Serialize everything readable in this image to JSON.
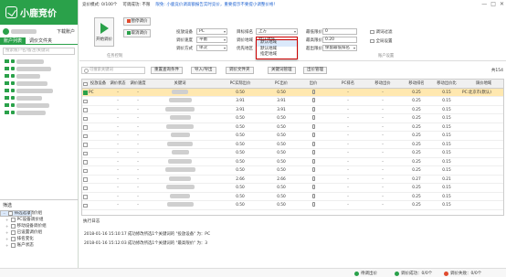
{
  "app": {
    "name": "小鹿竞价"
  },
  "user": {
    "download_label": "下载账户"
  },
  "sidebar": {
    "tabs": [
      "账户列表",
      "调价文件夹"
    ],
    "search_placeholder": "搜索账户名/备注/关键词",
    "accounts": [
      "",
      "",
      "",
      "",
      "",
      "",
      "",
      ""
    ]
  },
  "filter": {
    "title": "筛选",
    "items": [
      {
        "label": "筛选选项",
        "toggle": "−",
        "selected": true
      },
      {
        "label": "未设置调价组",
        "toggle": "",
        "selected": false
      },
      {
        "label": "PC设备调价组",
        "toggle": "+",
        "selected": false
      },
      {
        "label": "移动设备调价组",
        "toggle": "+",
        "selected": false
      },
      {
        "label": "已设置调价组",
        "toggle": "+",
        "selected": false
      },
      {
        "label": "排名变化",
        "toggle": "+",
        "selected": false
      },
      {
        "label": "账户状态",
        "toggle": "+",
        "selected": false
      }
    ]
  },
  "status_bar": {
    "left": "竞价模式: 0/100个",
    "mid": "可调成功: 不限",
    "link": "限免: 小鹿竞价调高额报告实时竞价，重要提示不要提小调整价格！",
    "win": [
      "—",
      "□",
      "✕"
    ]
  },
  "controls": {
    "start": "开始调价",
    "pause": "暂停调价",
    "cancel": "取消调价",
    "group_task": "任务控制",
    "group_settings": "账户设置",
    "group_account": "账户设置",
    "fields": [
      {
        "label": "投放设备",
        "value": "PC"
      },
      {
        "label": "调价速度",
        "value": "平衡"
      },
      {
        "label": "调价方式",
        "value": "单次"
      },
      {
        "label": "目标排名",
        "value": "上方"
      },
      {
        "label": "调价地域",
        "value": "默认地域"
      },
      {
        "label": "优先地区",
        "value": "全部地域"
      },
      {
        "label": "最低限价",
        "value": "0"
      },
      {
        "label": "最高限价",
        "value": "0.20"
      },
      {
        "label": "超出限价",
        "value": "保留最低排名"
      }
    ],
    "region_options": [
      "默认地域",
      "默认地域",
      "指定地域"
    ],
    "checks": [
      "调词过滤",
      "全局设置"
    ]
  },
  "toolbar": {
    "search_placeholder": "可搜索关键词",
    "buttons": [
      "重置查询条件",
      "导入/导出",
      "调价文件夹",
      "关键词管理",
      "出价管理"
    ],
    "count": "共154"
  },
  "table": {
    "headers": [
      "投放设备",
      "调价状态",
      "调价速度",
      "关键词",
      "PC实际出价",
      "PC出价",
      "出价",
      "PC排名",
      "移动出价",
      "移动排名",
      "移动出价比",
      "调价地域"
    ],
    "rows": [
      [
        "PC",
        "",
        "",
        "",
        "0.50",
        "0.50",
        "",
        "",
        "",
        "0.25",
        "0.15",
        "PC:北京市(默认)"
      ],
      [
        "",
        "",
        "",
        "",
        "3.91",
        "3.91",
        "",
        "",
        "",
        "0.25",
        "0.15",
        ""
      ],
      [
        "",
        "",
        "",
        "",
        "3.91",
        "3.91",
        "",
        "",
        "",
        "0.25",
        "0.15",
        ""
      ],
      [
        "",
        "",
        "",
        "",
        "0.50",
        "0.50",
        "",
        "",
        "",
        "0.25",
        "0.15",
        ""
      ],
      [
        "",
        "",
        "",
        "",
        "0.50",
        "0.50",
        "",
        "",
        "",
        "0.25",
        "0.15",
        ""
      ],
      [
        "",
        "",
        "",
        "",
        "0.50",
        "0.50",
        "",
        "",
        "",
        "0.25",
        "0.15",
        ""
      ],
      [
        "",
        "",
        "",
        "",
        "0.50",
        "0.50",
        "",
        "",
        "",
        "0.25",
        "0.15",
        ""
      ],
      [
        "",
        "",
        "",
        "",
        "0.50",
        "0.50",
        "",
        "",
        "",
        "0.25",
        "0.15",
        ""
      ],
      [
        "",
        "",
        "",
        "",
        "0.50",
        "0.50",
        "",
        "",
        "",
        "0.25",
        "0.15",
        ""
      ],
      [
        "",
        "",
        "",
        "",
        "0.50",
        "0.50",
        "",
        "",
        "",
        "0.25",
        "0.15",
        ""
      ],
      [
        "",
        "",
        "",
        "",
        "2.66",
        "2.66",
        "",
        "",
        "",
        "0.27",
        "0.21",
        ""
      ],
      [
        "",
        "",
        "",
        "",
        "0.50",
        "0.50",
        "",
        "",
        "",
        "0.25",
        "0.15",
        ""
      ],
      [
        "",
        "",
        "",
        "",
        "0.50",
        "0.50",
        "",
        "",
        "",
        "0.25",
        "0.15",
        ""
      ],
      [
        "",
        "",
        "",
        "",
        "0.50",
        "0.50",
        "",
        "",
        "",
        "0.25",
        "0.15",
        ""
      ]
    ]
  },
  "log": {
    "title": "执行日志",
    "lines": [
      "2018-01-16 15:10:17 成功修改所选1个关键词的 \"投放设备\" 为：PC",
      "2018-01-16 15:12:03 成功修改所选1个关键词的 \"最高限价\" 为：3"
    ]
  },
  "footer": {
    "status": "待调出价",
    "success": "调价成功：0/0个",
    "fail": "调价失败：0/0个"
  }
}
